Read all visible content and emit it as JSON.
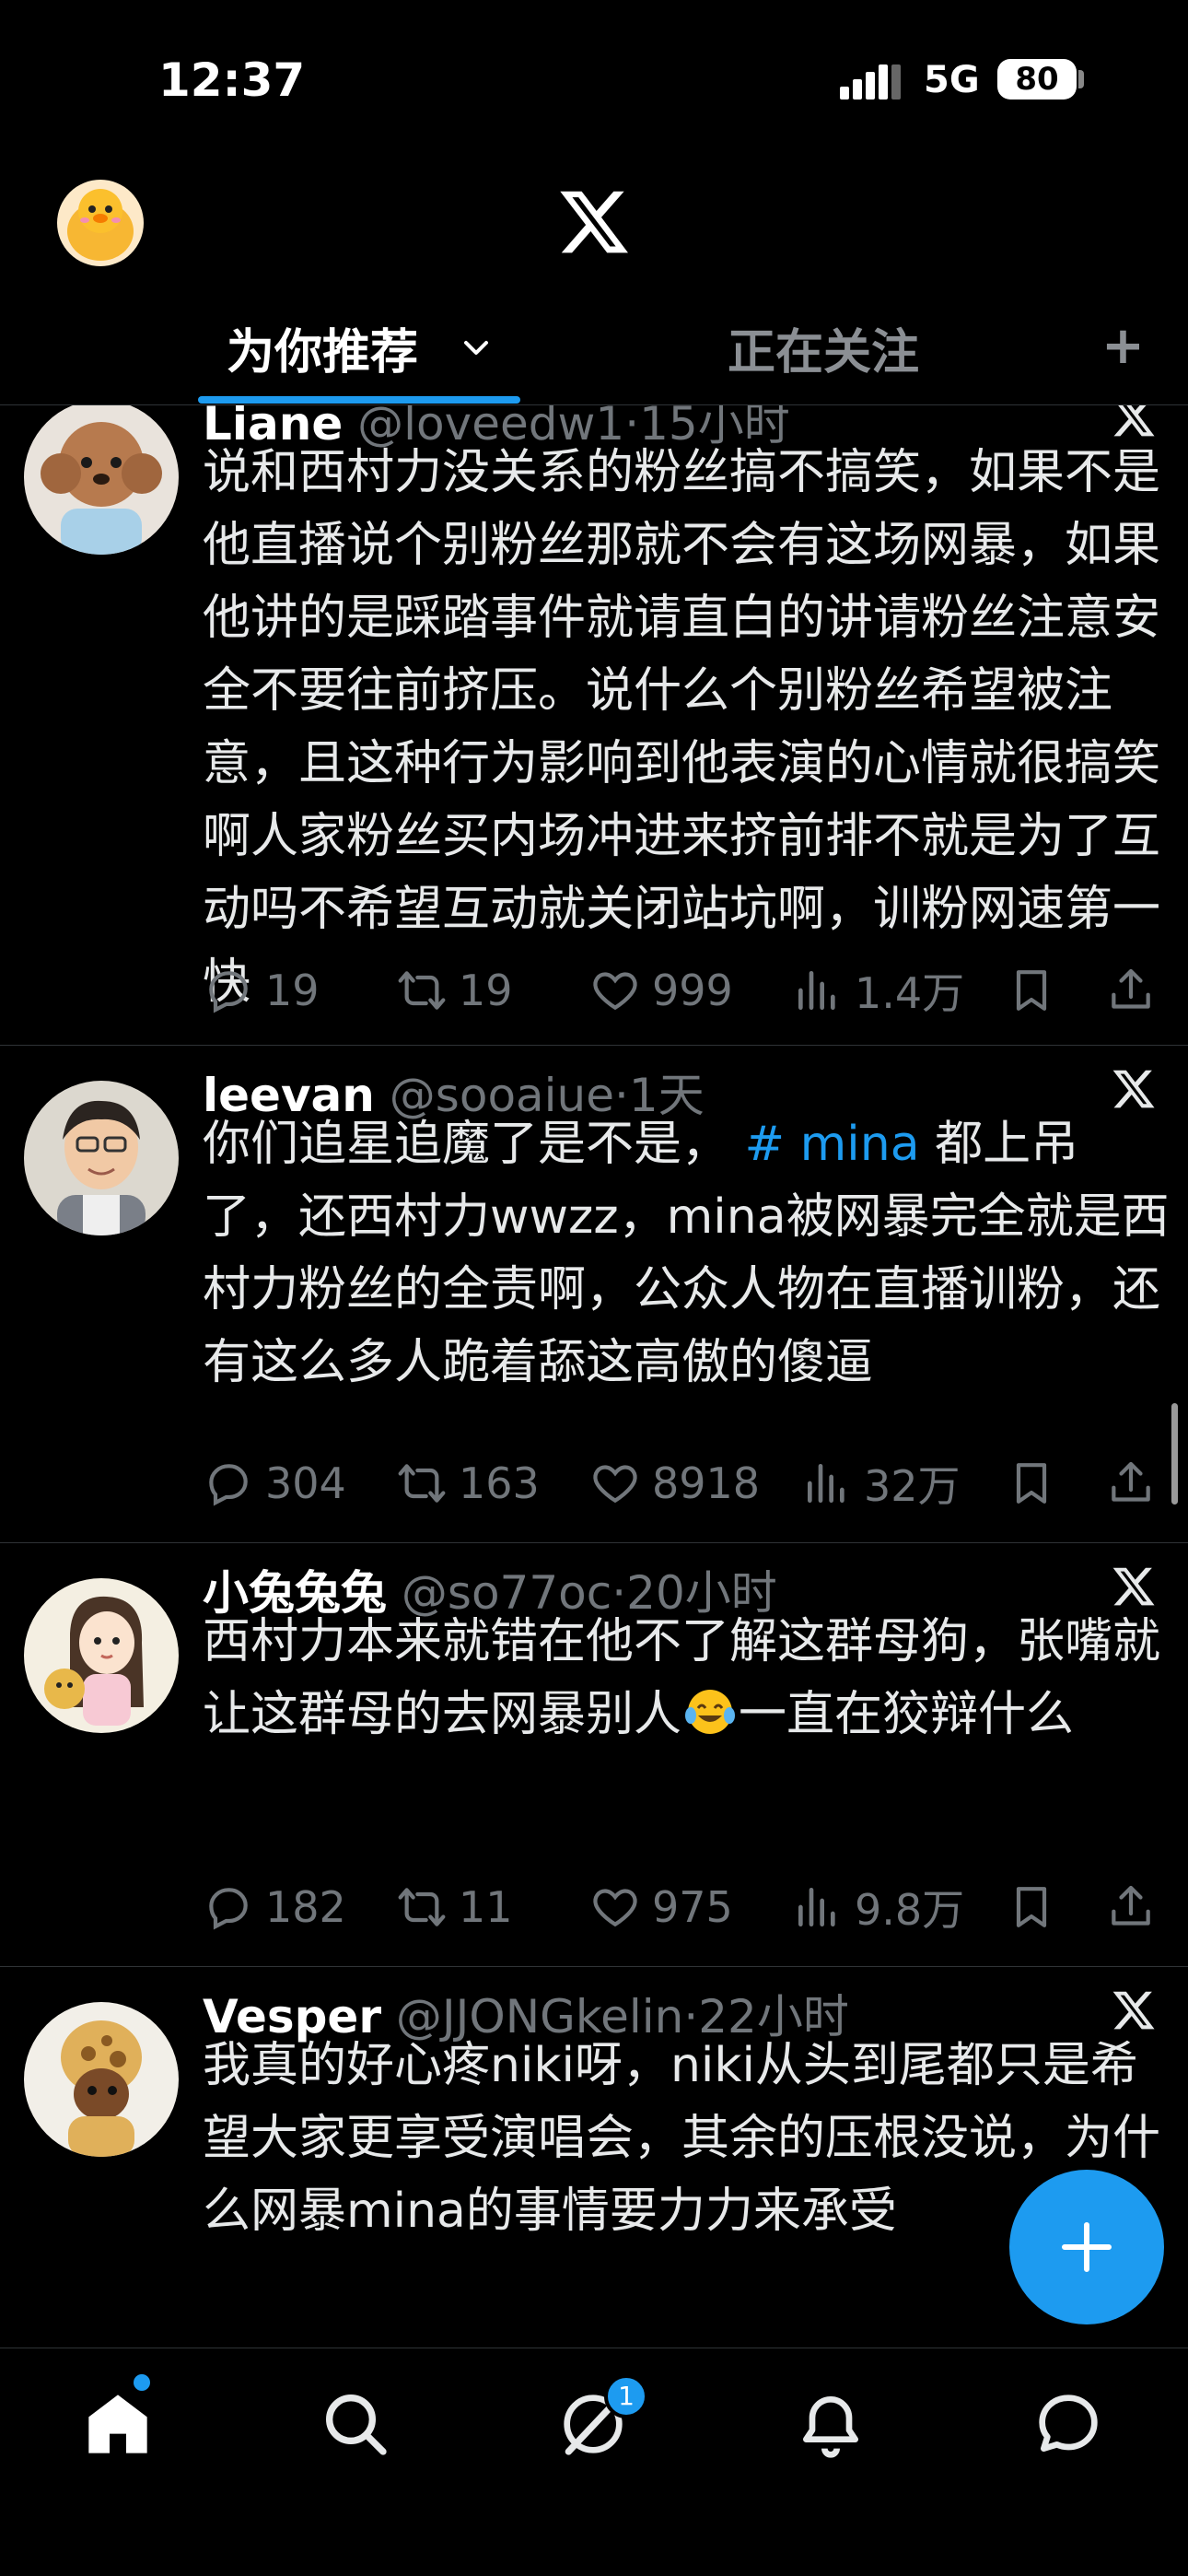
{
  "status_bar": {
    "time": "12:37",
    "network": "5G",
    "battery": "80"
  },
  "tabs": [
    {
      "label": "为你推荐",
      "active": true
    },
    {
      "label": "正在关注",
      "active": false
    }
  ],
  "accent_color": "#1d9bf0",
  "posts": [
    {
      "name": "Liane",
      "handle": "@loveedw1",
      "time": "15小时",
      "text": "说和西村力没关系的粉丝搞不搞笑，如果不是他直播说个别粉丝那就不会有这场网暴，如果他讲的是踩踏事件就请直白的讲请粉丝注意安全不要往前挤压。说什么个别粉丝希望被注意，且这种行为影响到他表演的心情就很搞笑啊人家粉丝买内场冲进来挤前排不就是为了互动吗不希望互动就关闭站坑啊，训粉网速第一快",
      "replies": "19",
      "reposts": "19",
      "likes": "999",
      "views": "1.4万"
    },
    {
      "name": "leevan",
      "handle": "@sooaiue",
      "time": "1天",
      "text_before": "你们追星追魔了是不是，",
      "hashtag": "# mina",
      "text_after": "都上吊了，还西村力wwzz，mina被网暴完全就是西村力粉丝的全责啊，公众人物在直播训粉，还有这么多人跪着舔这高傲的傻逼",
      "replies": "304",
      "reposts": "163",
      "likes": "8918",
      "views": "32万"
    },
    {
      "name": "小兔兔兔",
      "handle": "@so77oc",
      "time": "20小时",
      "text_before": "西村力本来就错在他不了解这群母狗，张嘴就让这群母的去网暴别人",
      "text_after": "一直在狡辩什么",
      "replies": "182",
      "reposts": "11",
      "likes": "975",
      "views": "9.8万"
    },
    {
      "name": "Vesper",
      "handle": "@JJONGkelin",
      "time": "22小时",
      "text": "我真的好心疼niki呀，niki从头到尾都只是希望大家更享受演唱会，其余的压根没说，为什么网暴mina的事情要力力来承受"
    }
  ],
  "nav": {
    "messages_badge": "1"
  }
}
